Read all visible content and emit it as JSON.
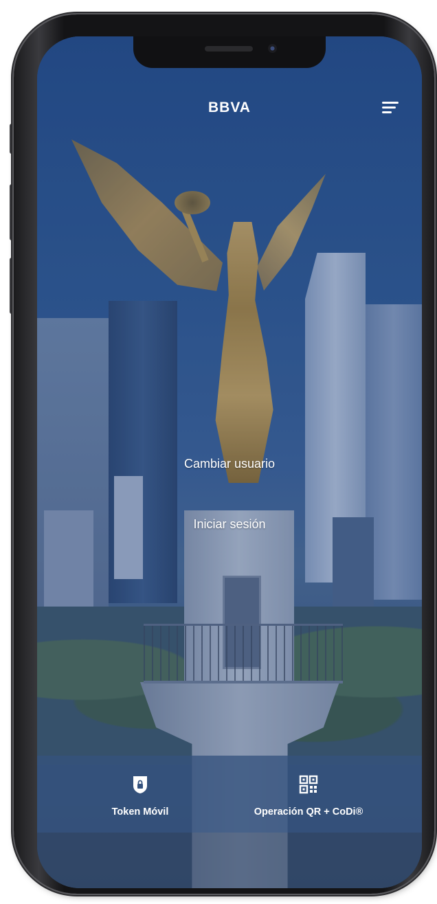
{
  "header": {
    "logo": "BBVA",
    "menu_icon": "hamburger-menu-icon"
  },
  "main": {
    "switch_user_label": "Cambiar usuario",
    "login_label": "Iniciar sesión"
  },
  "bottom_actions": [
    {
      "label": "Token Móvil",
      "icon": "shield-lock-icon"
    },
    {
      "label": "Operación QR + CoDi®",
      "icon": "qr-code-icon"
    }
  ],
  "colors": {
    "overlay": "#1e3e78",
    "bar": "#34527e",
    "text": "#ffffff"
  }
}
